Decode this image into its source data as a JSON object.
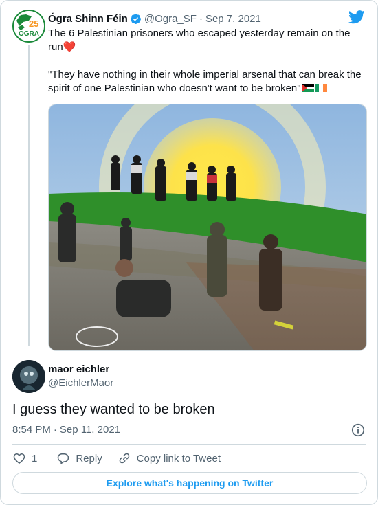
{
  "parent_tweet": {
    "author_name": "Ógra Shinn Féin",
    "handle": "@Ogra_SF",
    "separator": "·",
    "date": "Sep 7, 2021",
    "avatar_text": "ÓGRA",
    "avatar_number": "25",
    "line1": "The 6 Palestinian prisoners who escaped yesterday remain on the run",
    "heart": "❤️",
    "line2": "\"They have nothing in their whole imperial arsenal that can break the spirit of one Palestinian who doesn't want to be broken\"",
    "flags": [
      "palestine-flag",
      "ireland-flag"
    ]
  },
  "reply_tweet": {
    "author_name": "maor eichler",
    "handle": "@EichlerMaor",
    "text": "I guess they wanted to be broken",
    "time": "8:54 PM",
    "separator": "·",
    "date": "Sep 11, 2021"
  },
  "actions": {
    "like_count": "1",
    "reply_label": "Reply",
    "copy_link_label": "Copy link to Tweet"
  },
  "footer": {
    "explore_label": "Explore what's happening on Twitter"
  },
  "colors": {
    "twitter_blue": "#1d9bf0",
    "heart": "#e0245e",
    "secondary_text": "#536471",
    "border": "#cfd9de"
  }
}
